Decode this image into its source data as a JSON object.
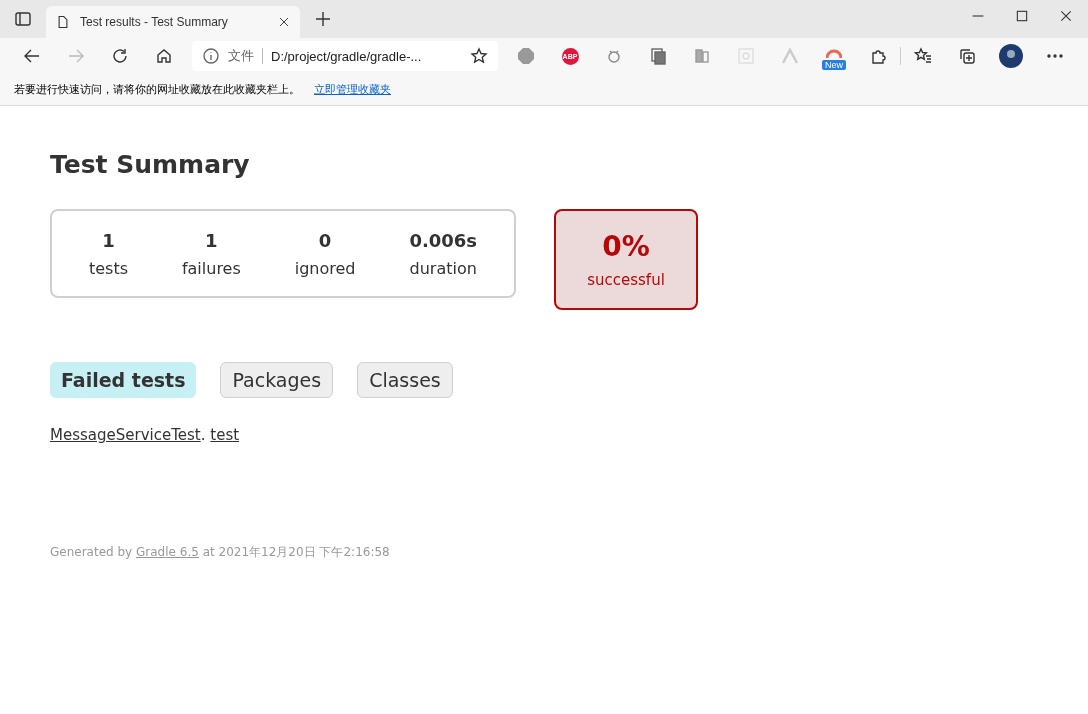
{
  "browser": {
    "tab_title": "Test results - Test Summary",
    "address_prefix": "文件",
    "address": "D:/project/gradle/gradle-...",
    "abp_label": "ABP",
    "new_badge": "New",
    "favorites_hint": "若要进行快速访问，请将你的网址收藏放在此收藏夹栏上。",
    "favorites_link": "立即管理收藏夹"
  },
  "page": {
    "title": "Test Summary",
    "counters": [
      {
        "value": "1",
        "label": "tests"
      },
      {
        "value": "1",
        "label": "failures"
      },
      {
        "value": "0",
        "label": "ignored"
      },
      {
        "value": "0.006s",
        "label": "duration"
      }
    ],
    "success": {
      "value": "0%",
      "label": "successful",
      "failed": true
    },
    "tabs": [
      {
        "label": "Failed tests",
        "selected": true
      },
      {
        "label": "Packages",
        "selected": false
      },
      {
        "label": "Classes",
        "selected": false
      }
    ],
    "failed_tests": [
      {
        "class": "MessageServiceTest",
        "separator": ".",
        "method": "test"
      }
    ],
    "footer": {
      "prefix": "Generated by",
      "link": "Gradle 6.5",
      "suffix": "at 2021年12月20日 下午2:16:58"
    }
  }
}
